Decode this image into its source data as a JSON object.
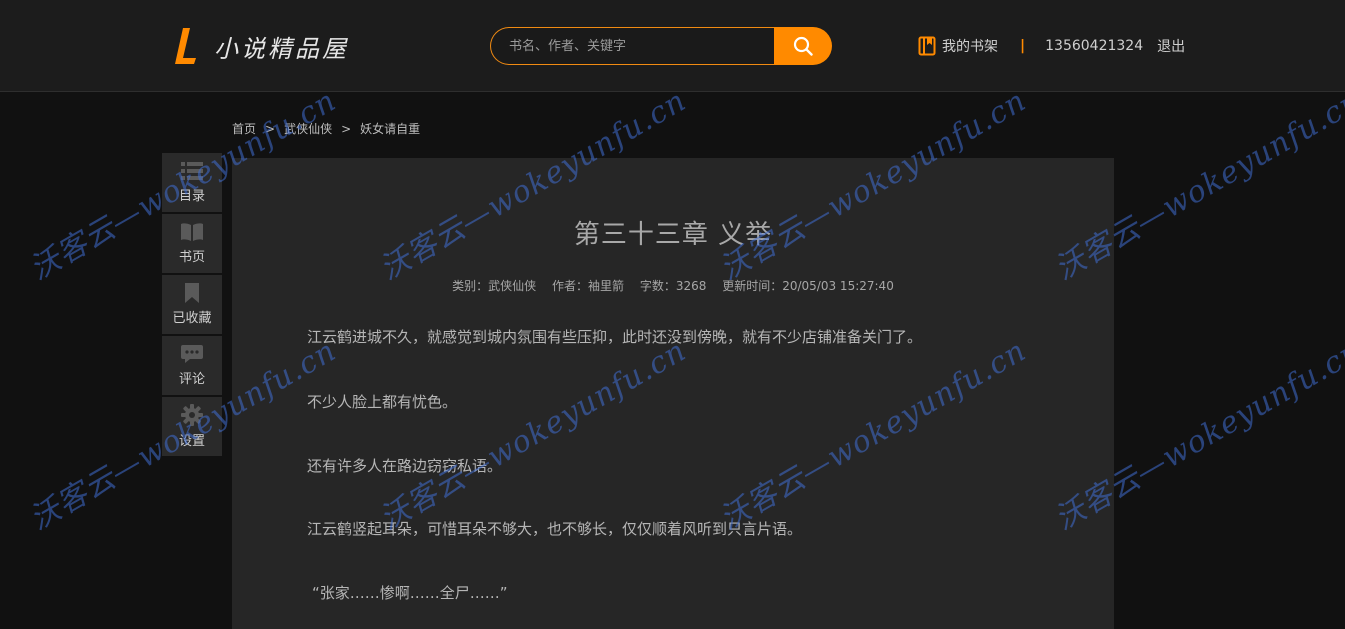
{
  "header": {
    "logo_text": "小说精品屋",
    "search_placeholder": "书名、作者、关键字",
    "bookshelf_label": "我的书架",
    "separator": "|",
    "phone": "13560421324",
    "logout_label": "退出"
  },
  "breadcrumb": {
    "home": "首页",
    "category": "武侠仙侠",
    "book": "妖女请自重",
    "gt": ">"
  },
  "sidebar": {
    "items": [
      {
        "label": "目录",
        "icon": "list-icon"
      },
      {
        "label": "书页",
        "icon": "book-icon"
      },
      {
        "label": "已收藏",
        "icon": "bookmark-icon"
      },
      {
        "label": "评论",
        "icon": "comment-icon"
      },
      {
        "label": "设置",
        "icon": "gear-icon"
      }
    ]
  },
  "chapter": {
    "title": "第三十三章 义举",
    "category": "类别：武侠仙侠",
    "author": "作者：袖里箭",
    "word_count": "字数：3268",
    "updated": "更新时间：20/05/03 15:27:40",
    "paragraphs": [
      "江云鹤进城不久，就感觉到城内氛围有些压抑，此时还没到傍晚，就有不少店铺准备关门了。",
      "不少人脸上都有忧色。",
      "还有许多人在路边窃窃私语。",
      "江云鹤竖起耳朵，可惜耳朵不够大，也不够长，仅仅顺着风听到只言片语。",
      "“张家……惨啊……全尸……”"
    ]
  },
  "watermark": {
    "text": "沃客云—wokeyunfu.cn"
  },
  "colors": {
    "accent": "#ff8a00",
    "header_bg": "#1c1c1c",
    "page_bg": "#111111",
    "content_bg": "#262626",
    "watermark": "#406ed2"
  }
}
